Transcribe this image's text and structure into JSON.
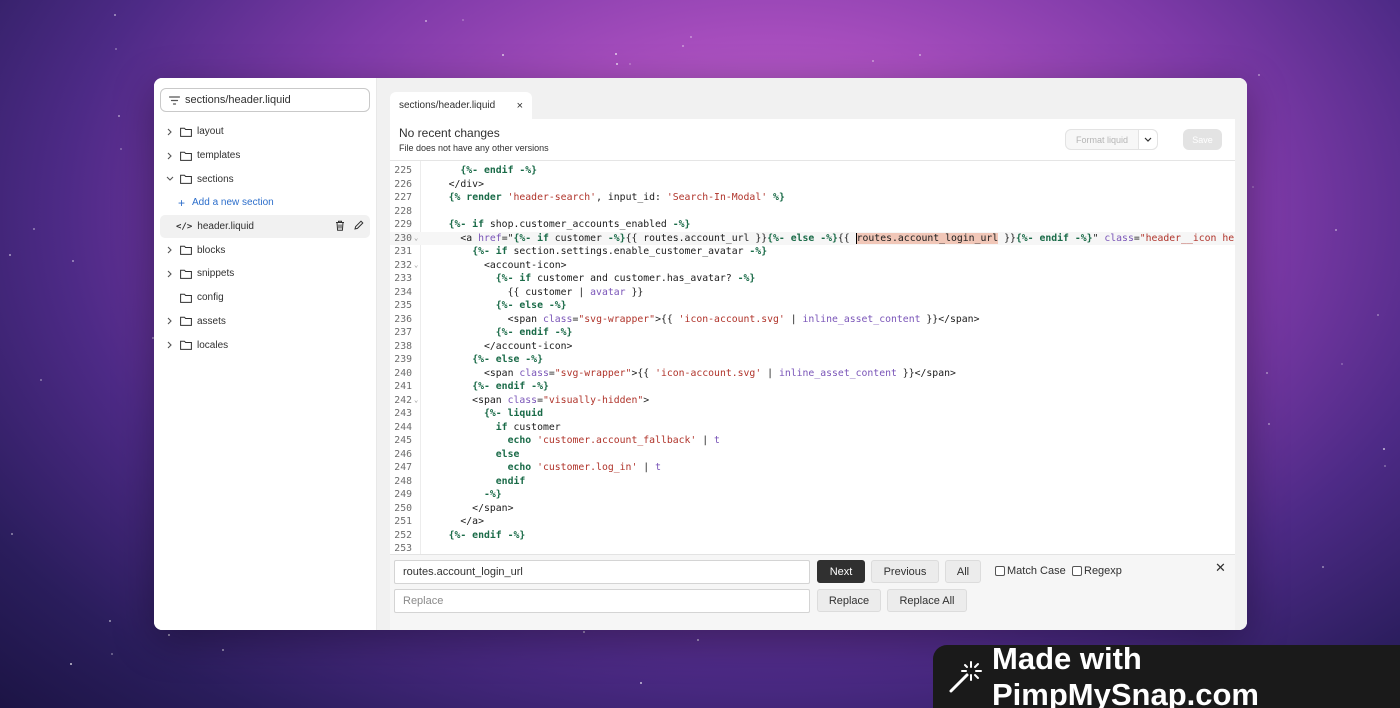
{
  "sidebar": {
    "search_value": "sections/header.liquid",
    "items": [
      {
        "label": "layout",
        "type": "folder",
        "expandable": true
      },
      {
        "label": "templates",
        "type": "folder",
        "expandable": true
      },
      {
        "label": "sections",
        "type": "folder",
        "expandable": true,
        "expanded": true
      },
      {
        "label": "Add a new section",
        "type": "add"
      },
      {
        "label": "header.liquid",
        "type": "file",
        "active": true
      },
      {
        "label": "blocks",
        "type": "folder",
        "expandable": true
      },
      {
        "label": "snippets",
        "type": "folder",
        "expandable": true
      },
      {
        "label": "config",
        "type": "folder",
        "expandable": false
      },
      {
        "label": "assets",
        "type": "folder",
        "expandable": true
      },
      {
        "label": "locales",
        "type": "folder",
        "expandable": true
      }
    ]
  },
  "tab": {
    "path_prefix": "sections/",
    "file": "header.liquid",
    "close": "×"
  },
  "info": {
    "title": "No recent changes",
    "subtitle": "File does not have any other versions",
    "format_label": "Format liquid",
    "save_label": "Save"
  },
  "code": {
    "current_line": 230,
    "lines": [
      {
        "n": "225",
        "fold": "",
        "tokens": [
          [
            "",
            "      "
          ],
          [
            "kw",
            "{%- endif -%}"
          ]
        ]
      },
      {
        "n": "226",
        "fold": "",
        "tokens": [
          [
            "",
            "    </div>"
          ]
        ]
      },
      {
        "n": "227",
        "fold": "",
        "tokens": [
          [
            "",
            "    "
          ],
          [
            "kw",
            "{%"
          ],
          [
            "",
            " "
          ],
          [
            "kw",
            "render"
          ],
          [
            "",
            " "
          ],
          [
            "str",
            "'header-search'"
          ],
          [
            "",
            ", input_id: "
          ],
          [
            "str",
            "'Search-In-Modal'"
          ],
          [
            "",
            " "
          ],
          [
            "kw",
            "%}"
          ]
        ]
      },
      {
        "n": "228",
        "fold": "",
        "tokens": [
          [
            "",
            ""
          ]
        ]
      },
      {
        "n": "229",
        "fold": "",
        "tokens": [
          [
            "",
            "    "
          ],
          [
            "kw",
            "{%- if"
          ],
          [
            "",
            " shop.customer_accounts_enabled "
          ],
          [
            "kw",
            "-%}"
          ]
        ]
      },
      {
        "n": "230",
        "fold": "⌄",
        "tokens": [
          [
            "",
            "      <a "
          ],
          [
            "attr",
            "href"
          ],
          [
            "",
            "=\""
          ],
          [
            "kw",
            "{%- if"
          ],
          [
            "",
            " customer "
          ],
          [
            "kw",
            "-%}"
          ],
          [
            "",
            "{{ routes.account_url }}"
          ],
          [
            "kw",
            "{%- else -%}"
          ],
          [
            "",
            "{{ "
          ],
          [
            "hl",
            "routes.account_login_url"
          ],
          [
            "",
            " }}"
          ],
          [
            "kw",
            "{%- endif -%}"
          ],
          [
            "",
            "\" "
          ],
          [
            "attr",
            "class"
          ],
          [
            "",
            "="
          ],
          [
            "str",
            "\"header__icon he"
          ]
        ]
      },
      {
        "n": "231",
        "fold": "",
        "tokens": [
          [
            "",
            "        "
          ],
          [
            "kw",
            "{%- if"
          ],
          [
            "",
            " section.settings.enable_customer_avatar "
          ],
          [
            "kw",
            "-%}"
          ]
        ]
      },
      {
        "n": "232",
        "fold": "⌄",
        "tokens": [
          [
            "",
            "          <account-icon>"
          ]
        ]
      },
      {
        "n": "233",
        "fold": "",
        "tokens": [
          [
            "",
            "            "
          ],
          [
            "kw",
            "{%- if"
          ],
          [
            "",
            " customer and customer.has_avatar? "
          ],
          [
            "kw",
            "-%}"
          ]
        ]
      },
      {
        "n": "234",
        "fold": "",
        "tokens": [
          [
            "",
            "              {{ customer | "
          ],
          [
            "fil",
            "avatar"
          ],
          [
            "",
            " }}"
          ]
        ]
      },
      {
        "n": "235",
        "fold": "",
        "tokens": [
          [
            "",
            "            "
          ],
          [
            "kw",
            "{%- else -%}"
          ]
        ]
      },
      {
        "n": "236",
        "fold": "",
        "tokens": [
          [
            "",
            "              <span "
          ],
          [
            "attr",
            "class"
          ],
          [
            "",
            "="
          ],
          [
            "str",
            "\"svg-wrapper\""
          ],
          [
            "",
            ">{{ "
          ],
          [
            "str",
            "'icon-account.svg'"
          ],
          [
            "",
            " | "
          ],
          [
            "fil",
            "inline_asset_content"
          ],
          [
            "",
            " }}</span>"
          ]
        ]
      },
      {
        "n": "237",
        "fold": "",
        "tokens": [
          [
            "",
            "            "
          ],
          [
            "kw",
            "{%- endif -%}"
          ]
        ]
      },
      {
        "n": "238",
        "fold": "",
        "tokens": [
          [
            "",
            "          </account-icon>"
          ]
        ]
      },
      {
        "n": "239",
        "fold": "",
        "tokens": [
          [
            "",
            "        "
          ],
          [
            "kw",
            "{%- else -%}"
          ]
        ]
      },
      {
        "n": "240",
        "fold": "",
        "tokens": [
          [
            "",
            "          <span "
          ],
          [
            "attr",
            "class"
          ],
          [
            "",
            "="
          ],
          [
            "str",
            "\"svg-wrapper\""
          ],
          [
            "",
            ">{{ "
          ],
          [
            "str",
            "'icon-account.svg'"
          ],
          [
            "",
            " | "
          ],
          [
            "fil",
            "inline_asset_content"
          ],
          [
            "",
            " }}</span>"
          ]
        ]
      },
      {
        "n": "241",
        "fold": "",
        "tokens": [
          [
            "",
            "        "
          ],
          [
            "kw",
            "{%- endif -%}"
          ]
        ]
      },
      {
        "n": "242",
        "fold": "⌄",
        "tokens": [
          [
            "",
            "        <span "
          ],
          [
            "attr",
            "class"
          ],
          [
            "",
            "="
          ],
          [
            "str",
            "\"visually-hidden\""
          ],
          [
            "",
            ">"
          ]
        ]
      },
      {
        "n": "243",
        "fold": "",
        "tokens": [
          [
            "",
            "          "
          ],
          [
            "kw",
            "{%- liquid"
          ]
        ]
      },
      {
        "n": "244",
        "fold": "",
        "tokens": [
          [
            "",
            "            "
          ],
          [
            "kw",
            "if"
          ],
          [
            "",
            " customer"
          ]
        ]
      },
      {
        "n": "245",
        "fold": "",
        "tokens": [
          [
            "",
            "              "
          ],
          [
            "kw",
            "echo"
          ],
          [
            "",
            " "
          ],
          [
            "str",
            "'customer.account_fallback'"
          ],
          [
            "",
            " | "
          ],
          [
            "fil",
            "t"
          ]
        ]
      },
      {
        "n": "246",
        "fold": "",
        "tokens": [
          [
            "",
            "            "
          ],
          [
            "kw",
            "else"
          ]
        ]
      },
      {
        "n": "247",
        "fold": "",
        "tokens": [
          [
            "",
            "              "
          ],
          [
            "kw",
            "echo"
          ],
          [
            "",
            " "
          ],
          [
            "str",
            "'customer.log_in'"
          ],
          [
            "",
            " | "
          ],
          [
            "fil",
            "t"
          ]
        ]
      },
      {
        "n": "248",
        "fold": "",
        "tokens": [
          [
            "",
            "            "
          ],
          [
            "kw",
            "endif"
          ]
        ]
      },
      {
        "n": "249",
        "fold": "",
        "tokens": [
          [
            "",
            "          "
          ],
          [
            "kw",
            "-%}"
          ]
        ]
      },
      {
        "n": "250",
        "fold": "",
        "tokens": [
          [
            "",
            "        </span>"
          ]
        ]
      },
      {
        "n": "251",
        "fold": "",
        "tokens": [
          [
            "",
            "      </a>"
          ]
        ]
      },
      {
        "n": "252",
        "fold": "",
        "tokens": [
          [
            "",
            "    "
          ],
          [
            "kw",
            "{%- endif -%}"
          ]
        ]
      },
      {
        "n": "253",
        "fold": "",
        "tokens": [
          [
            "",
            ""
          ]
        ]
      }
    ]
  },
  "search": {
    "find_value": "routes.account_login_url",
    "replace_placeholder": "Replace",
    "next_label": "Next",
    "previous_label": "Previous",
    "all_label": "All",
    "match_case_label": "Match Case",
    "regexp_label": "Regexp",
    "replace_label": "Replace",
    "replace_all_label": "Replace All",
    "close": "✕"
  },
  "watermark": {
    "text": "Made with PimpMySnap.com"
  },
  "colors": {
    "keyword": "#1a6b48",
    "string": "#b0342b",
    "attribute": "#7a55b8",
    "highlight": "#f1c7b8",
    "primary_button": "#303030",
    "link": "#2c6ecb"
  }
}
